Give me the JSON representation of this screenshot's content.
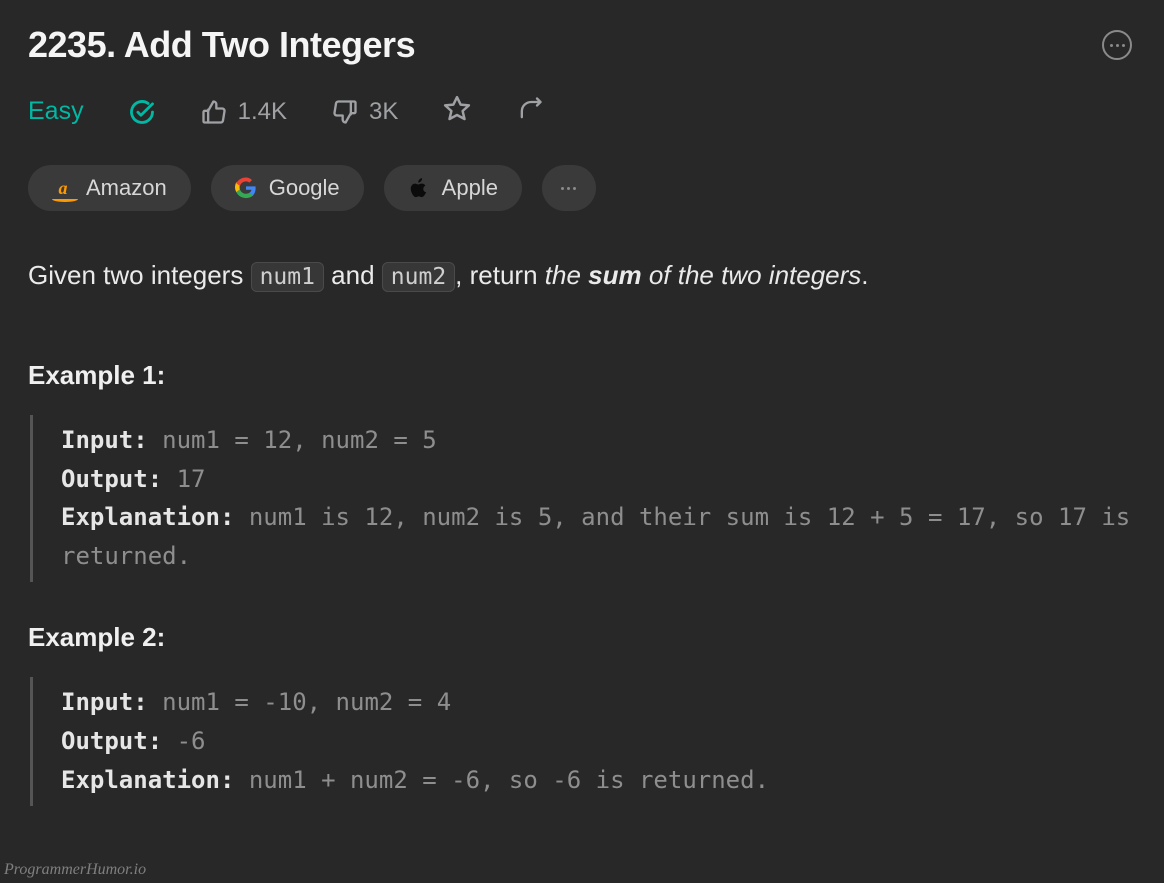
{
  "title": "2235. Add Two Integers",
  "difficulty": "Easy",
  "likes": "1.4K",
  "dislikes": "3K",
  "companies": [
    {
      "name": "Amazon",
      "icon": "amazon"
    },
    {
      "name": "Google",
      "icon": "google"
    },
    {
      "name": "Apple",
      "icon": "apple"
    }
  ],
  "description": {
    "prefix": "Given two integers ",
    "code1": "num1",
    "mid1": " and ",
    "code2": "num2",
    "mid2": ", return ",
    "em1": "the ",
    "strong": "sum",
    "em2": " of the two integers",
    "suffix": "."
  },
  "examples": [
    {
      "heading": "Example 1:",
      "input_label": "Input:",
      "input_value": " num1 = 12, num2 = 5",
      "output_label": "Output:",
      "output_value": " 17",
      "explanation_label": "Explanation:",
      "explanation_value": " num1 is 12, num2 is 5, and their sum is 12 + 5 = 17, so 17 is returned."
    },
    {
      "heading": "Example 2:",
      "input_label": "Input:",
      "input_value": " num1 = -10, num2 = 4",
      "output_label": "Output:",
      "output_value": " -6",
      "explanation_label": "Explanation:",
      "explanation_value": " num1 + num2 = -6, so -6 is returned."
    }
  ],
  "watermark": "ProgrammerHumor.io"
}
